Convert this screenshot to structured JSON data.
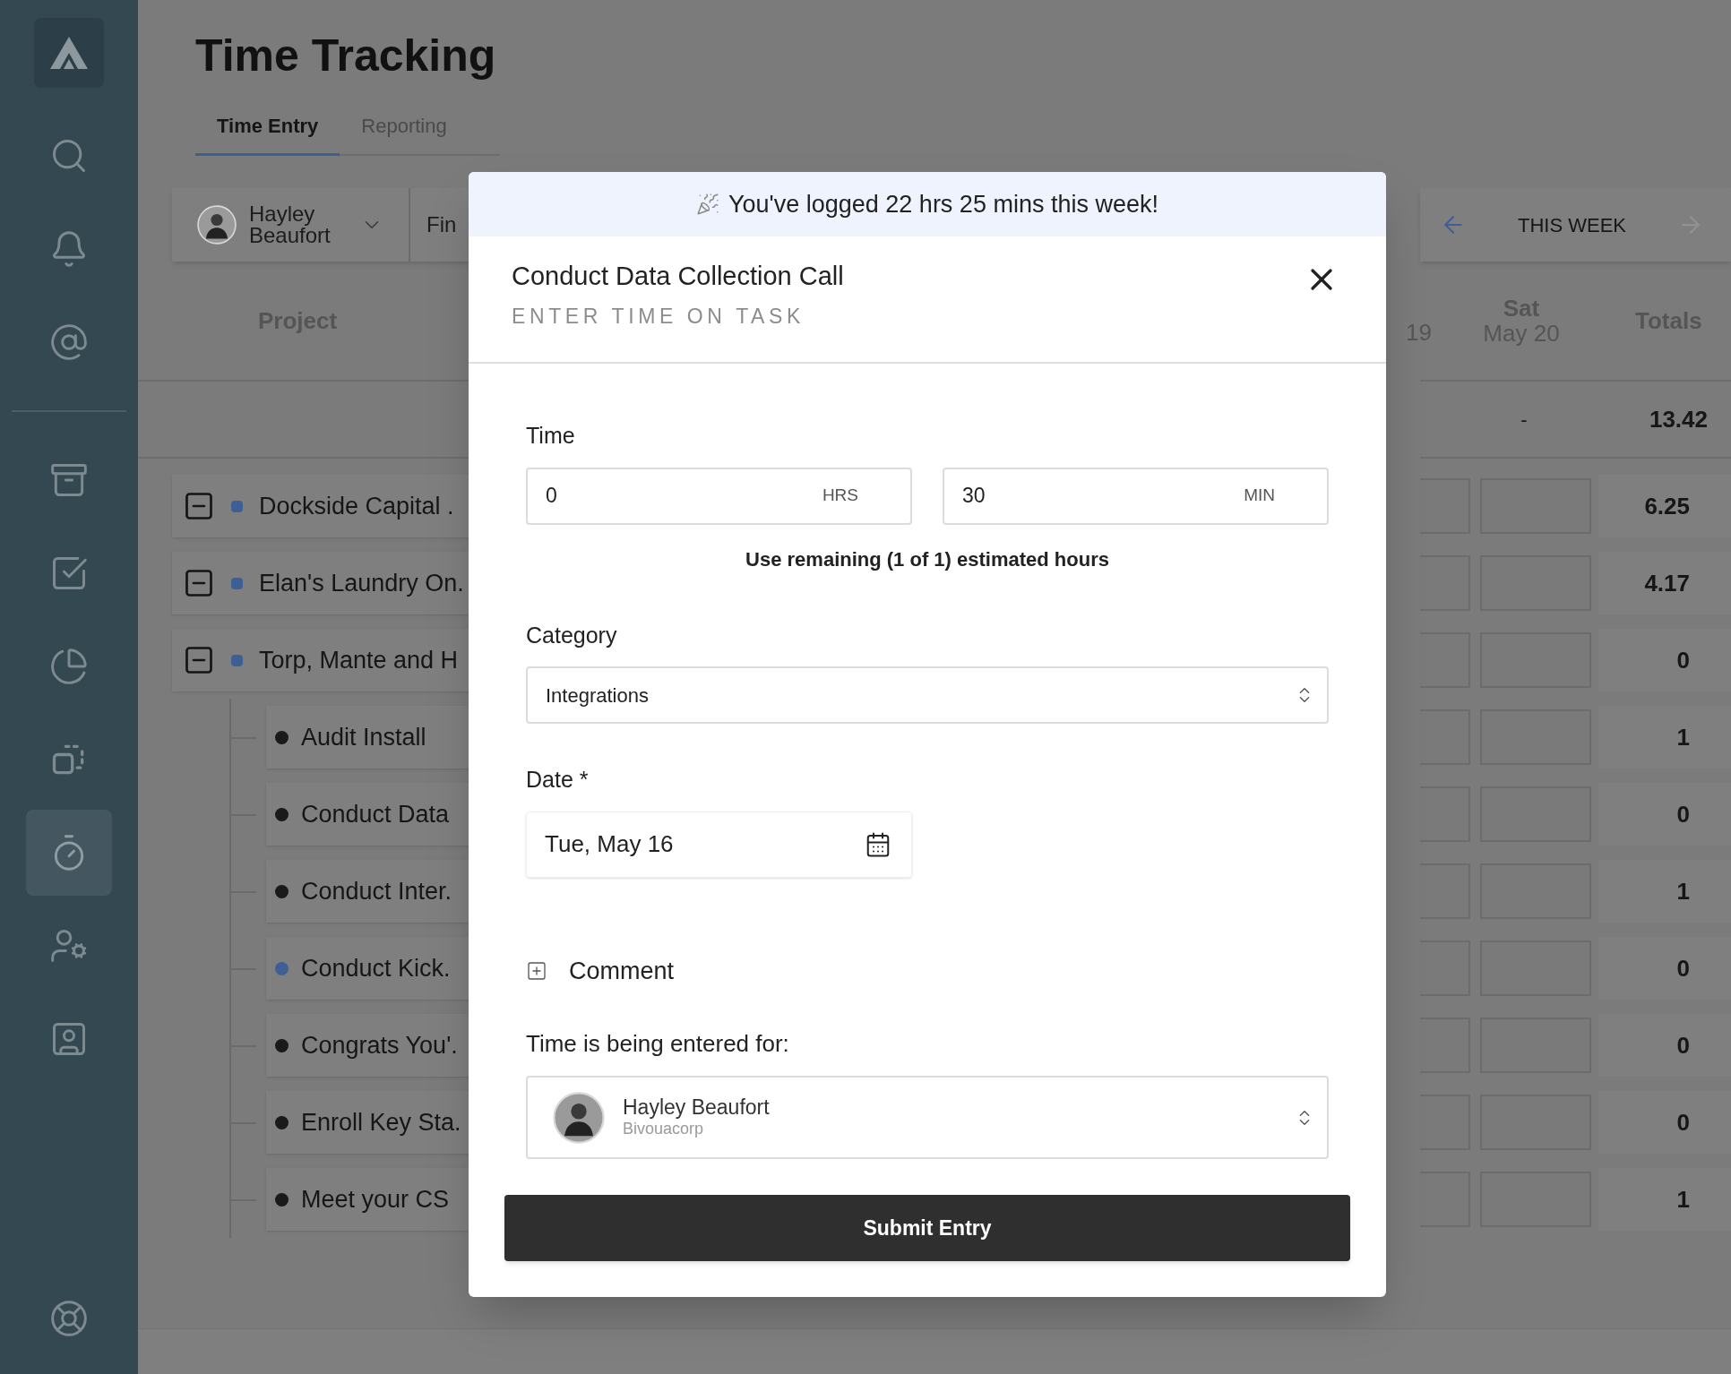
{
  "sidebar": {
    "items": [
      {
        "kind": "search",
        "selected": false
      },
      {
        "kind": "bell",
        "selected": false
      },
      {
        "kind": "at",
        "selected": false
      }
    ],
    "items_lower": [
      {
        "kind": "archive",
        "selected": false
      },
      {
        "kind": "check",
        "selected": false
      },
      {
        "kind": "pie",
        "selected": false
      },
      {
        "kind": "copy",
        "selected": false
      },
      {
        "kind": "timer",
        "selected": true
      },
      {
        "kind": "user-cog",
        "selected": false
      },
      {
        "kind": "contact",
        "selected": false
      }
    ],
    "footer_item": {
      "kind": "help",
      "selected": false
    }
  },
  "header": {
    "title": "Time Tracking",
    "tabs": [
      {
        "label": "Time Entry",
        "selected": true
      },
      {
        "label": "Reporting",
        "selected": false
      }
    ]
  },
  "toolbar": {
    "user": "Hayley Beaufort",
    "search_placeholder": "Fin"
  },
  "week_nav": {
    "label": "THIS WEEK"
  },
  "table": {
    "project_header": "Project",
    "partial_day": "19",
    "day_name": "Sat",
    "day_date": "May 20",
    "totals_header": "Totals",
    "summary": {
      "day": "-",
      "total": "13.42"
    },
    "rows": [
      {
        "kind": "project",
        "name": "Dockside Capital .",
        "color": "#3e5f96",
        "expanded": true,
        "total": "6.25"
      },
      {
        "kind": "project",
        "name": "Elan's Laundry On.",
        "color": "#3e5f96",
        "expanded": true,
        "total": "4.17"
      },
      {
        "kind": "project",
        "name": "Torp, Mante and H",
        "color": "#3e5f96",
        "expanded": true,
        "total": "0"
      },
      {
        "kind": "task",
        "name": "Audit Install",
        "color": "#1a1a1a",
        "total": "1"
      },
      {
        "kind": "task",
        "name": "Conduct Data",
        "color": "#1a1a1a",
        "total": "0"
      },
      {
        "kind": "task",
        "name": "Conduct Inter.",
        "color": "#1a1a1a",
        "total": "1"
      },
      {
        "kind": "task",
        "name": "Conduct Kick.",
        "color": "#3e5f96",
        "total": "0"
      },
      {
        "kind": "task",
        "name": "Congrats You'.",
        "color": "#1a1a1a",
        "total": "0"
      },
      {
        "kind": "task",
        "name": "Enroll Key Sta.",
        "color": "#1a1a1a",
        "total": "0"
      },
      {
        "kind": "task",
        "name": "Meet your CS",
        "color": "#1a1a1a",
        "total": "1"
      }
    ]
  },
  "modal": {
    "banner": "You've logged 22 hrs 25 mins this week!",
    "title": "Conduct Data Collection Call",
    "subtitle": "ENTER TIME ON TASK",
    "time_label": "Time",
    "hours": {
      "value": "0",
      "unit": "HRS"
    },
    "minutes": {
      "value": "30",
      "unit": "MIN"
    },
    "remaining": "Use remaining (1 of 1) estimated hours",
    "category": {
      "label": "Category",
      "value": "Integrations"
    },
    "date": {
      "label": "Date *",
      "value": "Tue, May 16"
    },
    "comment": {
      "label": "Comment",
      "expanded": false
    },
    "entered_for": {
      "label": "Time is being entered for:",
      "name": "Hayley Beaufort",
      "company": "Bivouacorp"
    },
    "submit": "Submit Entry"
  }
}
